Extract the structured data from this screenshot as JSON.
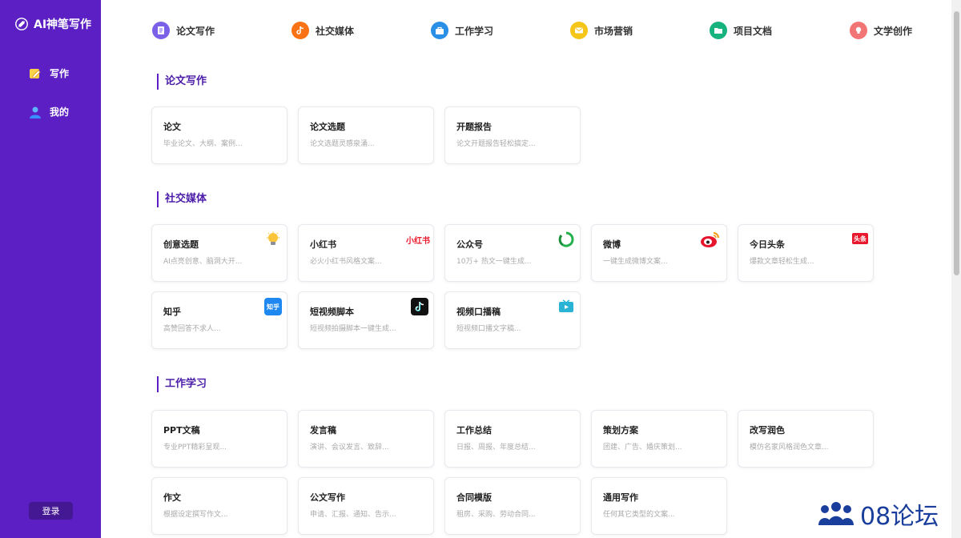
{
  "sidebar": {
    "brand": "AI神笔写作",
    "nav": [
      {
        "label": "写作"
      },
      {
        "label": "我的"
      }
    ],
    "login_label": "登录"
  },
  "top_categories": [
    {
      "label": "论文写作",
      "color": "#7b61e8",
      "icon": "document-icon"
    },
    {
      "label": "社交媒体",
      "color": "#f97316",
      "icon": "tiktok-note-icon"
    },
    {
      "label": "工作学习",
      "color": "#2a8fe6",
      "icon": "briefcase-icon"
    },
    {
      "label": "市场营销",
      "color": "#f5c518",
      "icon": "envelope-icon"
    },
    {
      "label": "项目文档",
      "color": "#16b37e",
      "icon": "folder-icon"
    },
    {
      "label": "文学创作",
      "color": "#f27474",
      "icon": "bulb-icon"
    }
  ],
  "sections": [
    {
      "title": "论文写作",
      "cards": [
        {
          "title": "论文",
          "desc": "毕业论文、大纲、案例..."
        },
        {
          "title": "论文选题",
          "desc": "论文选题灵感泉涌..."
        },
        {
          "title": "开题报告",
          "desc": "论文开题报告轻松搞定..."
        }
      ]
    },
    {
      "title": "社交媒体",
      "cards": [
        {
          "title": "创意选题",
          "desc": "AI点亮创意、脑洞大开...",
          "badge": "lightbulb-icon"
        },
        {
          "title": "小红书",
          "desc": "必火小红书风格文案...",
          "badge": "xiaohongshu-logo",
          "badge_text": "小红书"
        },
        {
          "title": "公众号",
          "desc": "10万+ 热文一键生成...",
          "badge": "wechat-official-icon"
        },
        {
          "title": "微博",
          "desc": "一键生成微博文案...",
          "badge": "weibo-icon"
        },
        {
          "title": "今日头条",
          "desc": "爆款文章轻松生成...",
          "badge": "toutiao-logo",
          "badge_text": "头条"
        },
        {
          "title": "知乎",
          "desc": "高赞回答不求人...",
          "badge": "zhihu-logo",
          "badge_text": "知乎"
        },
        {
          "title": "短视频脚本",
          "desc": "短视频拍摄脚本一键生成...",
          "badge": "douyin-icon"
        },
        {
          "title": "视频口播稿",
          "desc": "短视频口播文字稿...",
          "badge": "tv-icon"
        }
      ]
    },
    {
      "title": "工作学习",
      "cards": [
        {
          "title": "PPT文稿",
          "desc": "专业PPT精彩呈现..."
        },
        {
          "title": "发言稿",
          "desc": "演讲、会议发言、致辞..."
        },
        {
          "title": "工作总结",
          "desc": "日报、周报、年度总结..."
        },
        {
          "title": "策划方案",
          "desc": "团建、广告、婚庆策划..."
        },
        {
          "title": "改写润色",
          "desc": "模仿名家风格润色文章..."
        },
        {
          "title": "作文",
          "desc": "根据设定撰写作文..."
        },
        {
          "title": "公文写作",
          "desc": "申请、汇报、通知、告示..."
        },
        {
          "title": "合同模版",
          "desc": "租房、采购、劳动合同..."
        },
        {
          "title": "通用写作",
          "desc": "任何其它类型的文案..."
        }
      ]
    }
  ],
  "watermark": "08论坛"
}
